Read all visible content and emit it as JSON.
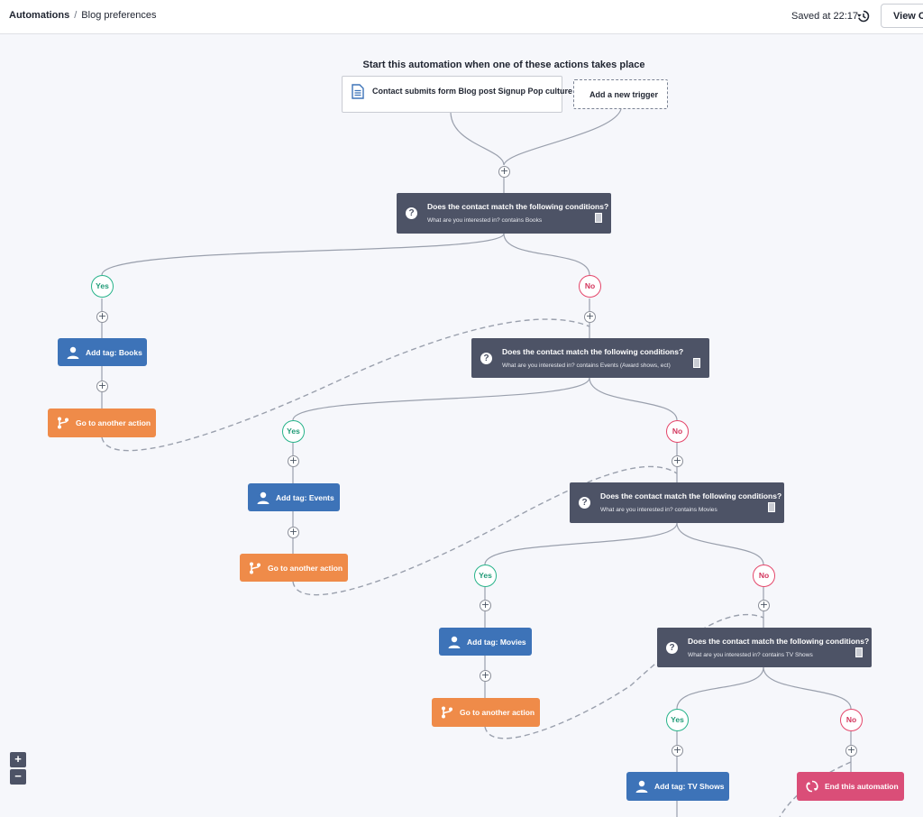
{
  "header": {
    "breadcrumb_root": "Automations",
    "breadcrumb_separator": "/",
    "breadcrumb_current": "Blog preferences",
    "saved_text": "Saved at 22:17",
    "history_icon": "history-icon",
    "view_button": "View Co"
  },
  "start": {
    "title": "Start this automation when one of these actions takes place",
    "trigger_label": "Contact submits form Blog post Signup Pop culture",
    "trigger_icon": "form-document-icon",
    "add_trigger_label": "Add a new trigger"
  },
  "plus_symbol": "+",
  "conditions": [
    {
      "title": "Does the contact match the following conditions?",
      "detail": "What are you interested in? contains Books"
    },
    {
      "title": "Does the contact match the following conditions?",
      "detail": "What are you interested in? contains Events (Award shows, ect)"
    },
    {
      "title": "Does the contact match the following conditions?",
      "detail": "What are you interested in? contains Movies"
    },
    {
      "title": "Does the contact match the following conditions?",
      "detail": "What are you interested in? contains TV Shows"
    }
  ],
  "condition_icon": "?",
  "branch_labels": {
    "yes": "Yes",
    "no": "No"
  },
  "actions": {
    "tag_books": "Add tag: Books",
    "tag_events": "Add tag: Events",
    "tag_movies": "Add tag: Movies",
    "tag_tv": "Add tag: TV Shows",
    "goto": "Go to another action",
    "end": "End this automation"
  },
  "zoom": {
    "in": "+",
    "out": "−"
  },
  "colors": {
    "condition": "#4d5366",
    "tag_action": "#3d73b8",
    "goto_action": "#ef8b49",
    "end_action": "#da4e78",
    "yes": "#27b38a",
    "no": "#e4466a",
    "connector": "#9aa0ad"
  }
}
